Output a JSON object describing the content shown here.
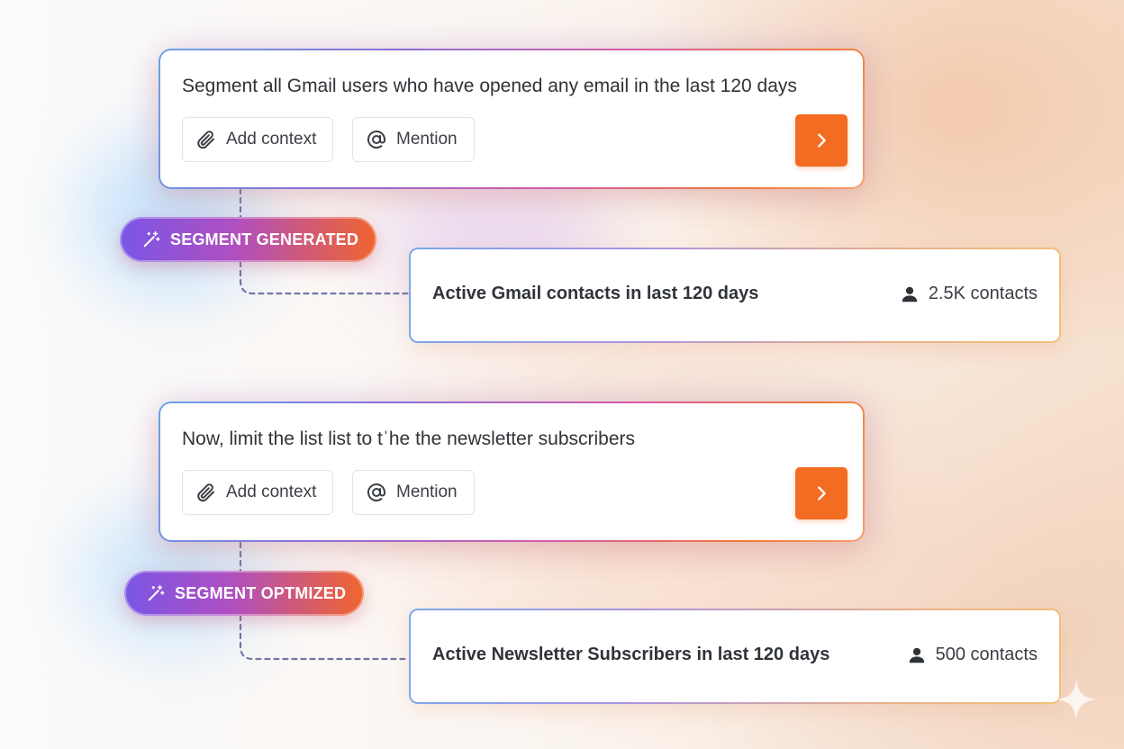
{
  "steps": [
    {
      "prompt": {
        "text": "Segment all Gmail users who have opened any email in the last 120 days",
        "add_context_label": "Add context",
        "mention_label": "Mention"
      },
      "badge_label": "SEGMENT GENERATED",
      "result": {
        "title": "Active Gmail contacts in last 120 days",
        "count": "2.5K contacts"
      }
    },
    {
      "prompt": {
        "text": "Now, limit the list list to tˈhe the newsletter subscribers",
        "add_context_label": "Add context",
        "mention_label": "Mention"
      },
      "badge_label": "SEGMENT OPTMIZED",
      "result": {
        "title": "Active Newsletter Subscribers in last 120 days",
        "count": "500 contacts"
      }
    }
  ],
  "colors": {
    "accent_orange": "#f36c21",
    "gradient_purple": "#7a56e6",
    "gradient_pink": "#b04fc0",
    "connector_dash": "#6f78a8"
  },
  "icons": {
    "attach": "paperclip-icon",
    "mention": "at-sign-icon",
    "send": "chevron-right-icon",
    "badge": "magic-wand-icon",
    "contacts": "person-icon",
    "decoration": "sparkle-icon"
  }
}
